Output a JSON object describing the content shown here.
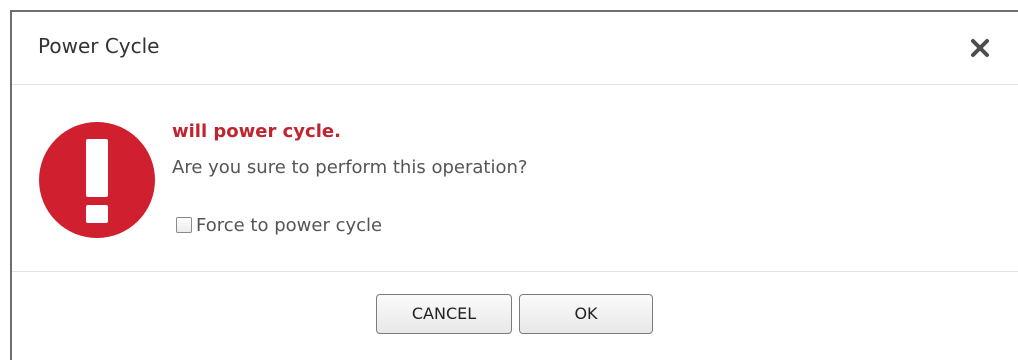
{
  "dialog": {
    "title": "Power Cycle",
    "close_icon": "close-icon",
    "alert_icon": "exclamation-circle-icon",
    "message_title": "will power cycle.",
    "message_text": "Are you sure to perform this operation?",
    "force_checkbox": {
      "label": "Force to power cycle",
      "checked": false
    },
    "buttons": {
      "cancel": "CANCEL",
      "ok": "OK"
    }
  },
  "colors": {
    "alert_red": "#d0202f",
    "message_title": "#c0242f",
    "text": "#555555"
  }
}
